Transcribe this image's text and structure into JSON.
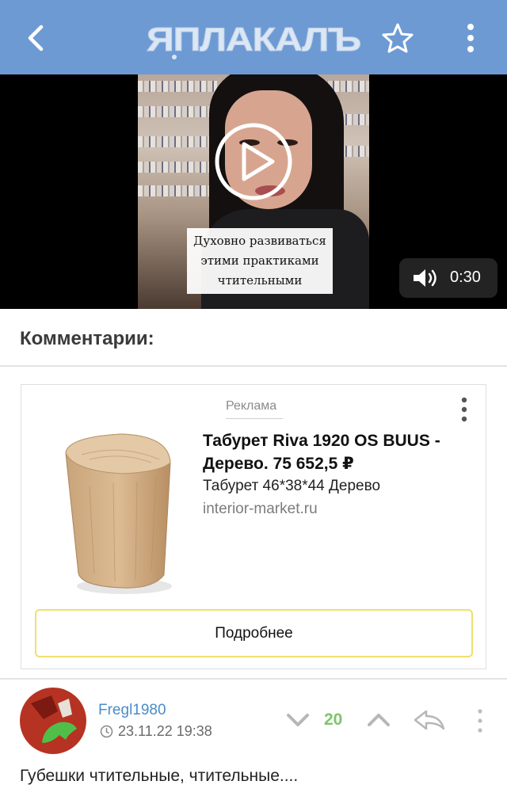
{
  "header": {
    "logo_text": "ЯПЛАКАЛЪ",
    "background": "#6e9ad4",
    "icons": [
      "back-arrow-icon",
      "star-icon",
      "more-vertical-icon"
    ]
  },
  "video": {
    "caption": "Духовно развиваться этими практиками чтительными",
    "duration": "0:30",
    "icons": [
      "play-icon",
      "volume-icon"
    ]
  },
  "comments": {
    "title": "Комментарии:"
  },
  "ad": {
    "label": "Реклама",
    "title": "Табурет Riva 1920 OS BUUS - Дерево. 75 652,5 ₽",
    "description": "Табурет 46*38*44 Дерево",
    "domain": "interior-market.ru",
    "button_label": "Подробнее",
    "button_border": "#f0df6d"
  },
  "comment": {
    "username": "Fregl1980",
    "timestamp": "23.11.22 19:38",
    "score": "20",
    "score_color": "#7ec46b",
    "username_color": "#4a8cc9",
    "text": "Губешки чтительные, чтительные...."
  }
}
